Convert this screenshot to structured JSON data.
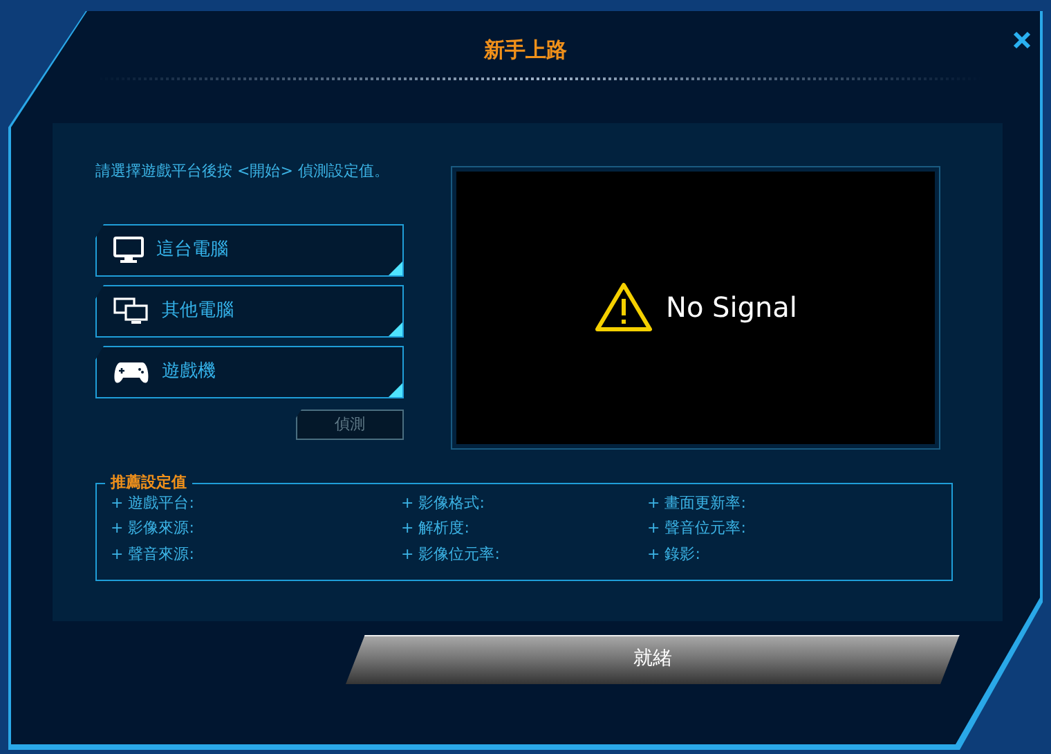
{
  "window": {
    "title": "新手上路"
  },
  "instruction": "請選擇遊戲平台後按 <開始> 偵測設定值。",
  "platforms": [
    {
      "label": "這台電腦",
      "selected": false
    },
    {
      "label": "其他電腦",
      "selected": false
    },
    {
      "label": "遊戲機",
      "selected": false
    }
  ],
  "detect_button": {
    "label": "偵測",
    "disabled": true
  },
  "preview": {
    "message": "No Signal"
  },
  "recommended": {
    "legend": "推薦設定值",
    "items": [
      "+ 遊戲平台:",
      "+ 影像格式:",
      "+ 畫面更新率:",
      "+ 影像來源:",
      "+ 解析度:",
      "+ 聲音位元率:",
      "+ 聲音來源:",
      "+ 影像位元率:",
      "+ 錄影:"
    ]
  },
  "ready_button": {
    "label": "就緒",
    "disabled": false
  }
}
